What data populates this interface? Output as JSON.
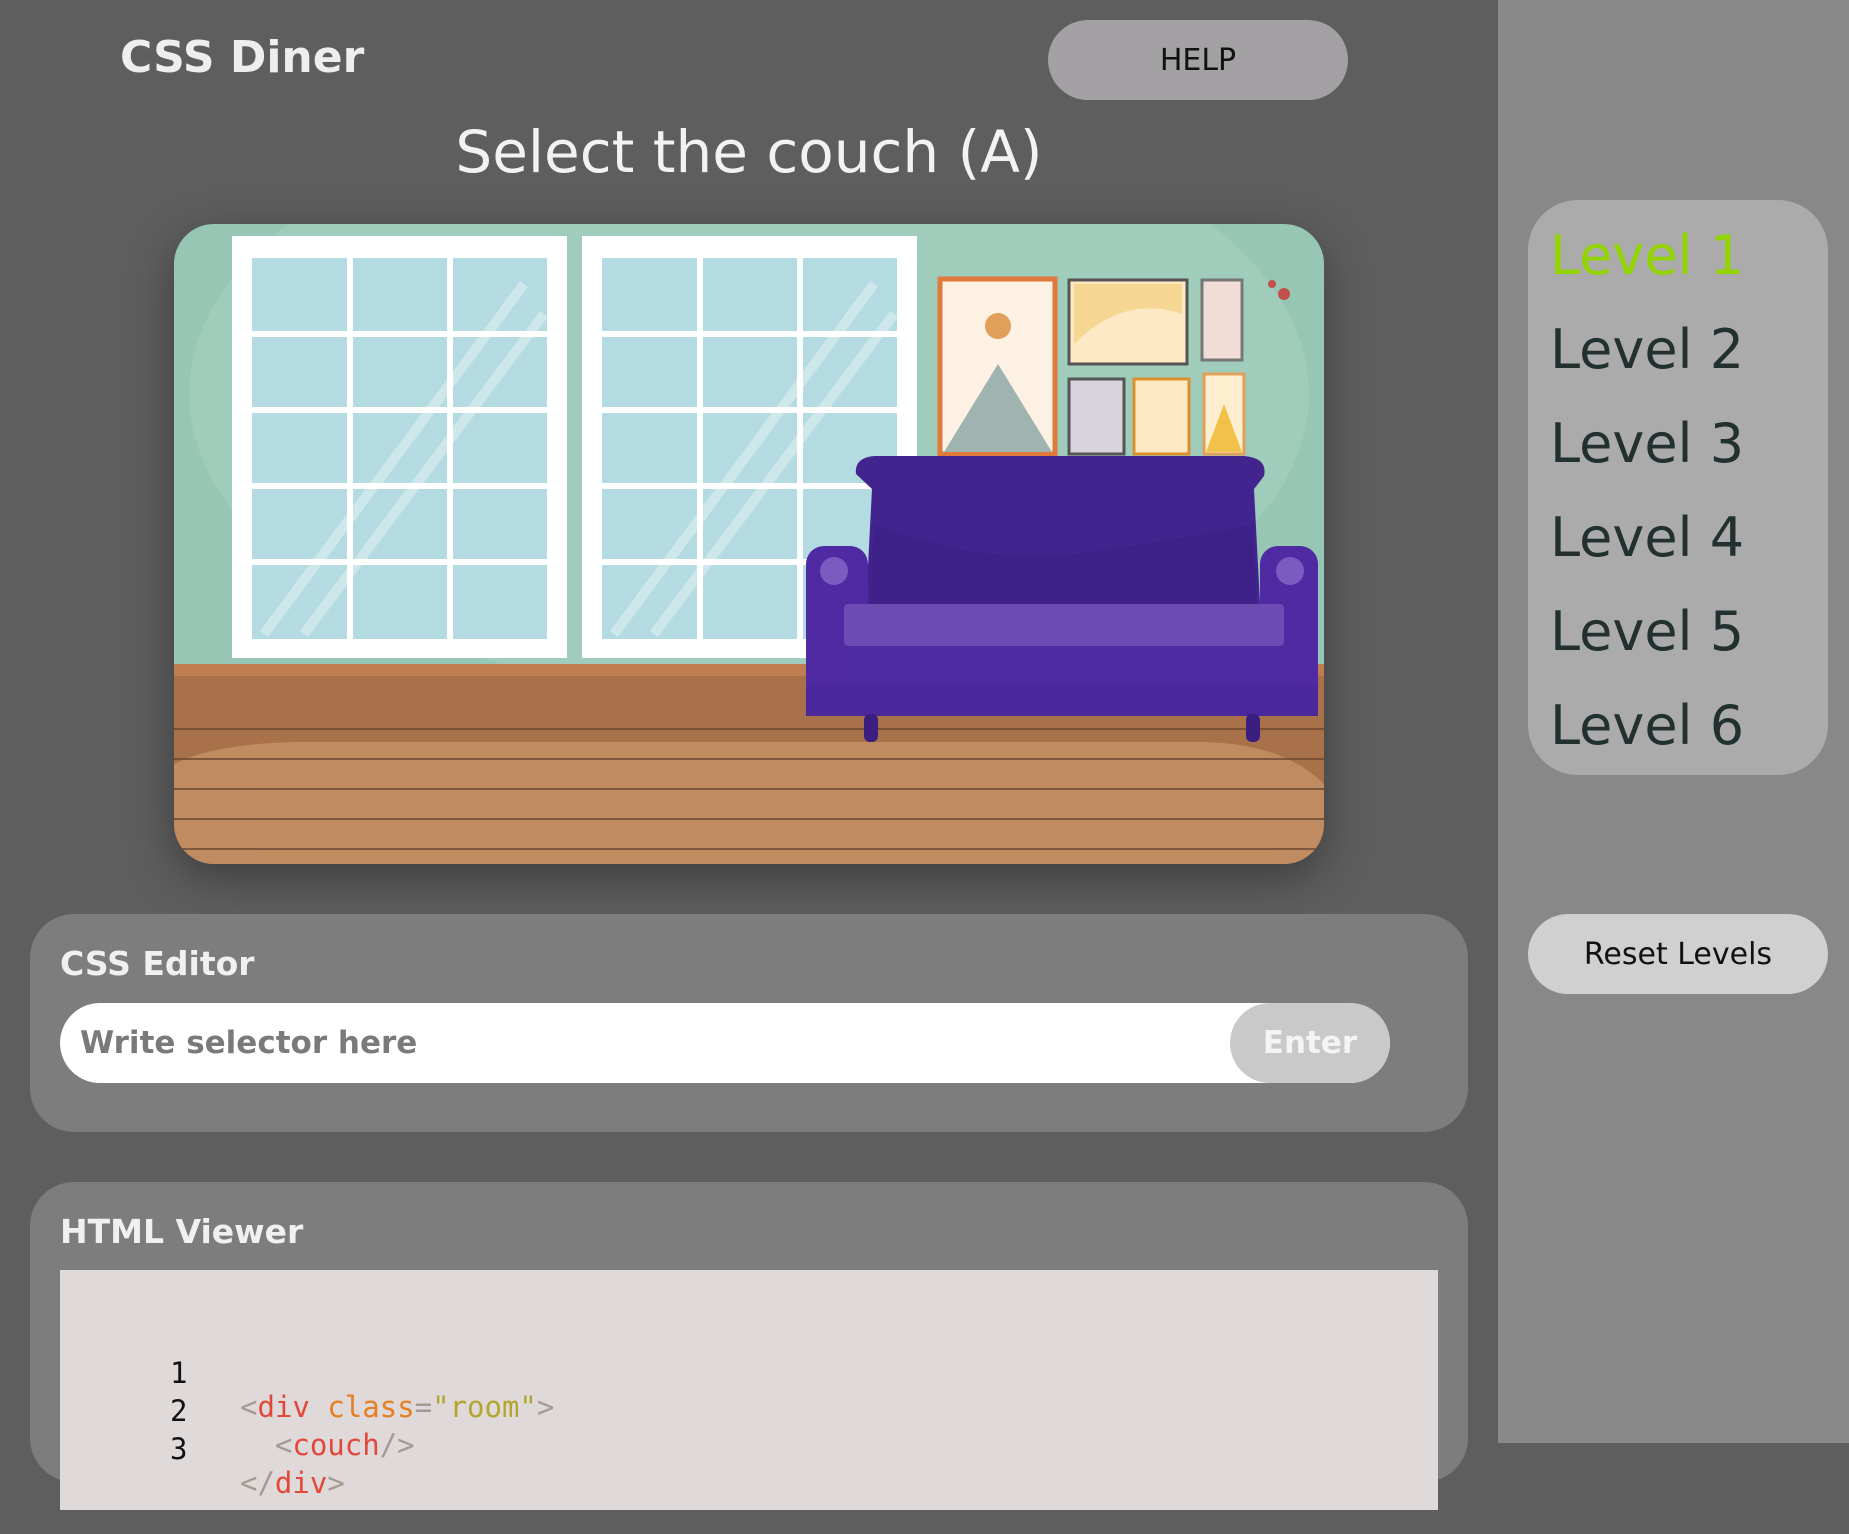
{
  "header": {
    "app_title": "CSS Diner",
    "help_label": "HELP"
  },
  "instruction": "Select the couch (A)",
  "editor": {
    "title": "CSS Editor",
    "placeholder": "Write selector here",
    "enter_label": "Enter"
  },
  "viewer": {
    "title": "HTML Viewer",
    "lines": [
      {
        "num": "1",
        "indent": "",
        "open": "<",
        "tag": "div",
        "attr": "class",
        "eq": "=",
        "val": "\"room\"",
        "close": ">"
      },
      {
        "num": "2",
        "indent": "  ",
        "open": "<",
        "tag": "couch",
        "close": "/>"
      },
      {
        "num": "3",
        "indent": "",
        "open": "</",
        "tag": "div",
        "close": ">"
      }
    ]
  },
  "sidebar": {
    "levels": [
      "Level 1",
      "Level 2",
      "Level 3",
      "Level 4",
      "Level 5",
      "Level 6"
    ],
    "active_level": 0,
    "reset_label": "Reset Levels"
  },
  "colors": {
    "active_level": "#93d400",
    "couch": "#4d2aa1",
    "wall": "#9ccbb9",
    "floor": "#a8714a"
  }
}
